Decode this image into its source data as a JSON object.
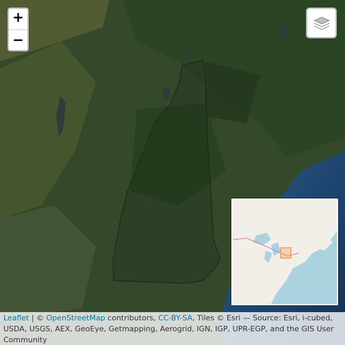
{
  "zoom": {
    "in_label": "+",
    "out_label": "−"
  },
  "layers": {
    "icon": "layers-icon"
  },
  "minimap": {
    "icon": "inset-overview-map"
  },
  "attribution": {
    "leaflet": "Leaflet",
    "sep1": " | © ",
    "osm": "OpenStreetMap",
    "contributors": " contributors, ",
    "license": "CC-BY-SA",
    "rest": ", Tiles © Esri — Source: Esri, i-cubed, USDA, USGS, AEX, GeoEye, Getmapping, Aerogrid, IGN, IGP, UPR-EGP, and the GIS User Community"
  },
  "colors": {
    "forest": "#2f4a26",
    "ocean": "#1f3d66",
    "boundary": "#1e2418",
    "minimap_water": "#aad3df",
    "minimap_land": "#f2efe9",
    "viewport": "#f39c4a",
    "link": "#0078a8"
  }
}
